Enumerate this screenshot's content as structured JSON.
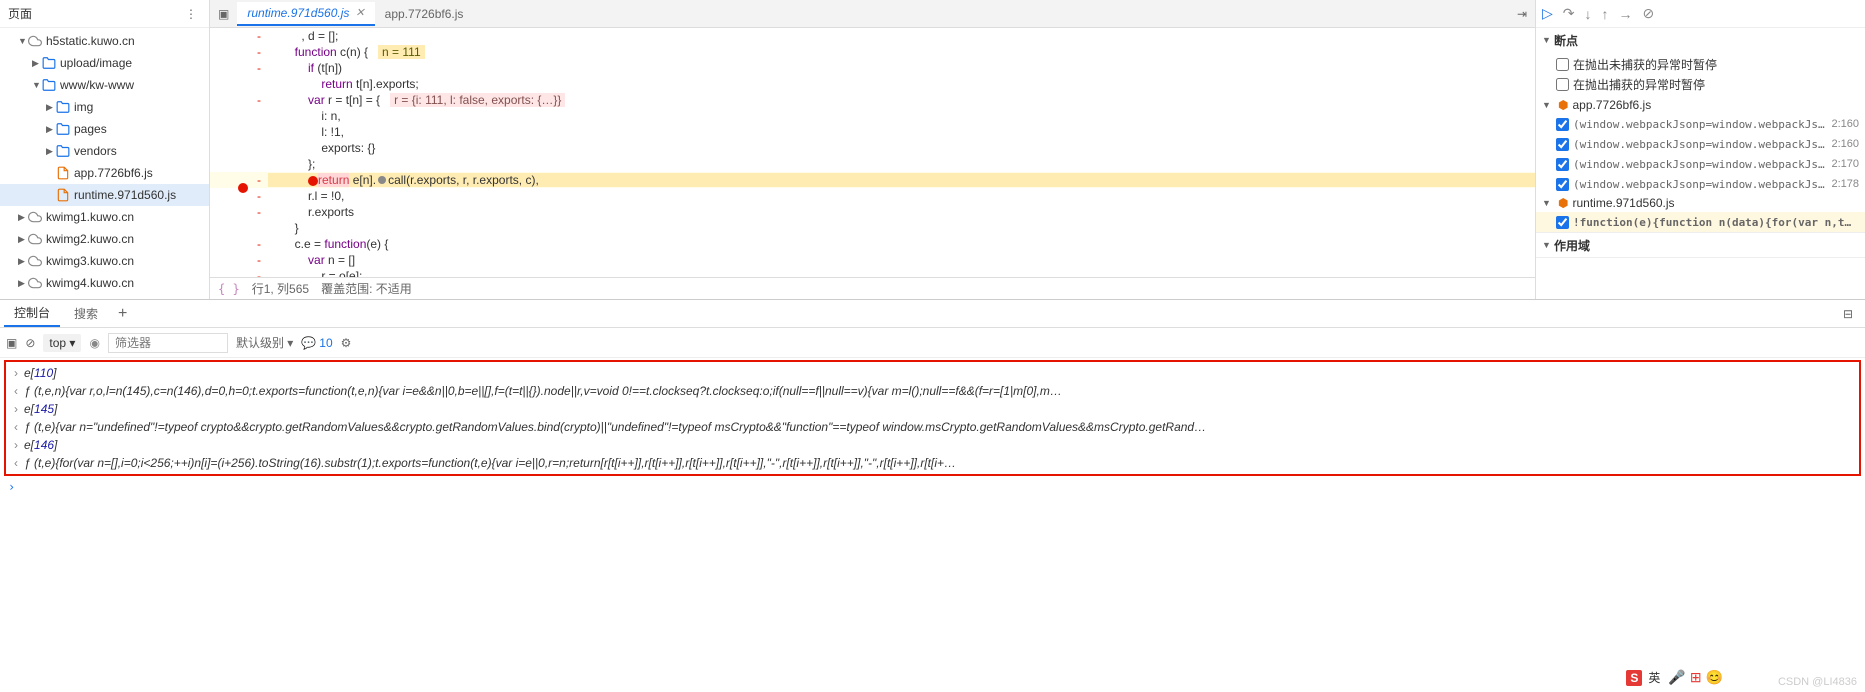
{
  "sidebar": {
    "title": "页面",
    "tree": [
      {
        "type": "cloud",
        "label": "h5static.kuwo.cn",
        "indent": 1,
        "expanded": true
      },
      {
        "type": "folder",
        "label": "upload/image",
        "indent": 2,
        "expanded": false
      },
      {
        "type": "folder",
        "label": "www/kw-www",
        "indent": 2,
        "expanded": true
      },
      {
        "type": "folder",
        "label": "img",
        "indent": 3,
        "expanded": false
      },
      {
        "type": "folder",
        "label": "pages",
        "indent": 3,
        "expanded": false
      },
      {
        "type": "folder",
        "label": "vendors",
        "indent": 3,
        "expanded": false
      },
      {
        "type": "file",
        "label": "app.7726bf6.js",
        "indent": 3
      },
      {
        "type": "file",
        "label": "runtime.971d560.js",
        "indent": 3,
        "selected": true
      },
      {
        "type": "cloud",
        "label": "kwimg1.kuwo.cn",
        "indent": 1,
        "expanded": false
      },
      {
        "type": "cloud",
        "label": "kwimg2.kuwo.cn",
        "indent": 1,
        "expanded": false
      },
      {
        "type": "cloud",
        "label": "kwimg3.kuwo.cn",
        "indent": 1,
        "expanded": false
      },
      {
        "type": "cloud",
        "label": "kwimg4.kuwo.cn",
        "indent": 1,
        "expanded": false
      }
    ]
  },
  "tabs": {
    "items": [
      {
        "label": "runtime.971d560.js",
        "active": true
      },
      {
        "label": "app.7726bf6.js",
        "active": false
      }
    ]
  },
  "code": {
    "lines": [
      {
        "dash": "-",
        "text": "          , d = [];"
      },
      {
        "dash": "-",
        "text": "        function c(n) {   ",
        "hint": "n = 111"
      },
      {
        "dash": "-",
        "text": "            if (t[n])"
      },
      {
        "dash": "",
        "text": "                return t[n].exports;"
      },
      {
        "dash": "-",
        "text": "            var r = t[n] = {   ",
        "hint2": "r = {i: 111, l: false, exports: {…}}"
      },
      {
        "dash": "",
        "text": "                i: n,"
      },
      {
        "dash": "",
        "text": "                l: !1,"
      },
      {
        "dash": "",
        "text": "                exports: {}"
      },
      {
        "dash": "",
        "text": "            };"
      },
      {
        "dash": "-",
        "text": "",
        "breakpoint": true,
        "exec": true,
        "return": "return",
        "rest": " e[n].",
        "pause": true,
        "rest2": "call(r.exports, r, r.exports, c),"
      },
      {
        "dash": "-",
        "text": "            r.l = !0,"
      },
      {
        "dash": "-",
        "text": "            r.exports"
      },
      {
        "dash": "",
        "text": "        }"
      },
      {
        "dash": "-",
        "text": "        c.e = function(e) {"
      },
      {
        "dash": "-",
        "text": "            var n = []"
      },
      {
        "dash": "-",
        "text": "              , r = o[e];"
      }
    ]
  },
  "status": {
    "pos": "行1, 列565",
    "coverage": "覆盖范围: 不适用"
  },
  "debug_toolbar": [
    "resume",
    "step-over",
    "step-into",
    "step-out",
    "step",
    "deactivate"
  ],
  "breakpoints": {
    "title": "断点",
    "pause_uncaught": "在抛出未捕获的异常时暂停",
    "pause_caught": "在抛出捕获的异常时暂停",
    "files": [
      {
        "name": "app.7726bf6.js",
        "items": [
          {
            "checked": true,
            "text": "(window.webpackJsonp=window.webpackJs…",
            "pos": "2:160"
          },
          {
            "checked": true,
            "text": "(window.webpackJsonp=window.webpackJs…",
            "pos": "2:160"
          },
          {
            "checked": true,
            "text": "(window.webpackJsonp=window.webpackJs…",
            "pos": "2:170"
          },
          {
            "checked": true,
            "text": "(window.webpackJsonp=window.webpackJs…",
            "pos": "2:178"
          }
        ]
      },
      {
        "name": "runtime.971d560.js",
        "hl": true,
        "items": [
          {
            "checked": true,
            "text": "!function(e){function n(data){for(var n,t…",
            "pos": "",
            "hl": true
          }
        ]
      }
    ],
    "scope_title": "作用域"
  },
  "console_tabs": {
    "items": [
      "控制台",
      "搜索"
    ],
    "active": 0
  },
  "console_toolbar": {
    "context": "top",
    "filter_placeholder": "筛选器",
    "level": "默认级别",
    "issues": "10"
  },
  "console": {
    "lines": [
      {
        "dir": "in",
        "text": "e[",
        "num": "110",
        "text2": "]"
      },
      {
        "dir": "out",
        "fn": "ƒ (t,e,n){var r,o,l=n(145),c=n(146),d=0,h=0;t.exports=function(t,e,n){var i=e&&n||0,b=e||[],f=(t=t||{}).node||r,v=void 0!==t.clockseq?t.clockseq:o;if(null==f||null==v){var m=l();null==f&&(f=r=[1|m[0],m…"
      },
      {
        "dir": "in",
        "text": "e[",
        "num": "145",
        "text2": "]"
      },
      {
        "dir": "out",
        "fn": "ƒ (t,e){var n=\"undefined\"!=typeof crypto&&crypto.getRandomValues&&crypto.getRandomValues.bind(crypto)||\"undefined\"!=typeof msCrypto&&\"function\"==typeof window.msCrypto.getRandomValues&&msCrypto.getRand…"
      },
      {
        "dir": "in",
        "text": "e[",
        "num": "146",
        "text2": "]"
      },
      {
        "dir": "out",
        "fn": "ƒ (t,e){for(var n=[],i=0;i<256;++i)n[i]=(i+256).toString(16).substr(1);t.exports=function(t,e){var i=e||0,r=n;return[r[t[i++]],r[t[i++]],r[t[i++]],r[t[i++]],\"-\",r[t[i++]],r[t[i++]],\"-\",r[t[i++]],r[t[i+…"
      }
    ]
  },
  "footer": {
    "ime": "S",
    "ime_text": "英",
    "watermark": "CSDN @LI4836"
  }
}
